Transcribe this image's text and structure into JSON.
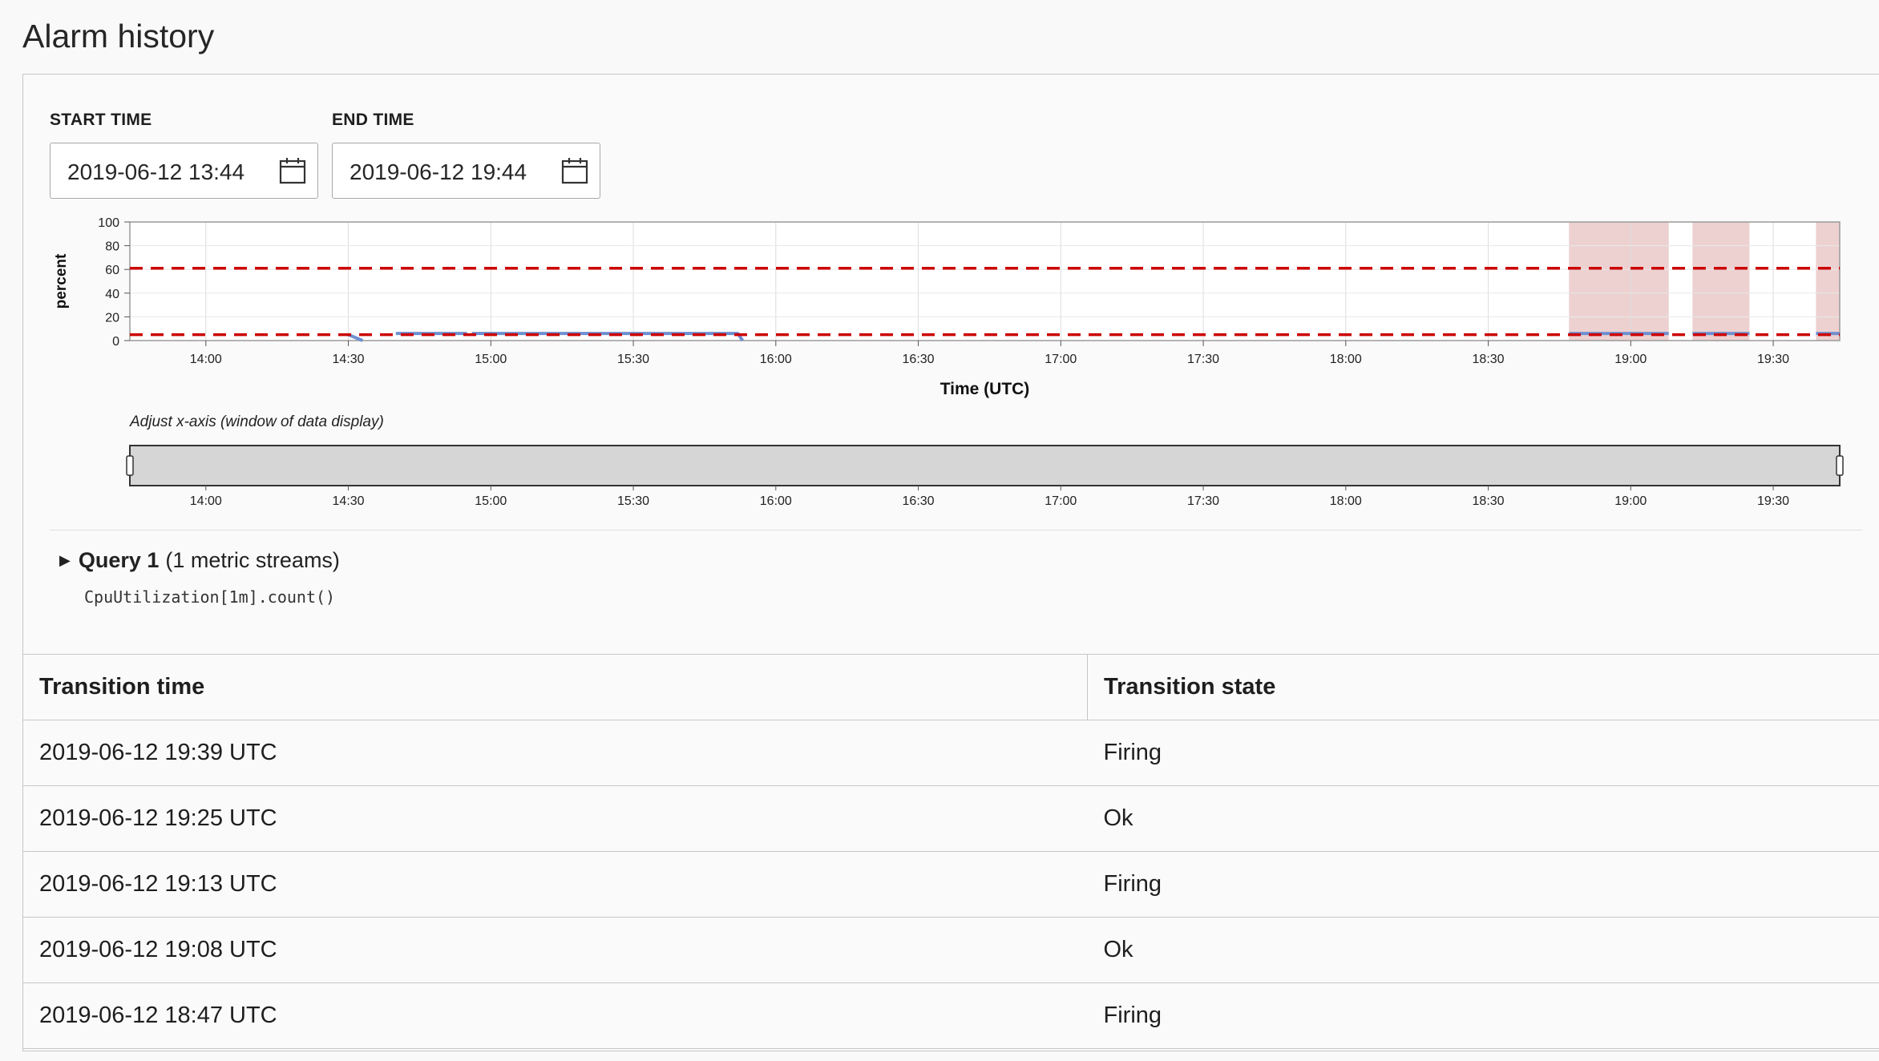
{
  "page_title": "Alarm history",
  "start_time": {
    "label": "START TIME",
    "value": "2019-06-12 13:44",
    "icon": "calendar-icon"
  },
  "end_time": {
    "label": "END TIME",
    "value": "2019-06-12 19:44",
    "icon": "calendar-icon"
  },
  "chart_data": {
    "type": "line",
    "ylabel": "percent",
    "xlabel": "Time (UTC)",
    "ylim": [
      0,
      100
    ],
    "y_ticks": [
      0,
      20,
      40,
      60,
      80,
      100
    ],
    "xlim": [
      "13:44",
      "19:44"
    ],
    "x_ticks": [
      "14:00",
      "14:30",
      "15:00",
      "15:30",
      "16:00",
      "16:30",
      "17:00",
      "17:30",
      "18:00",
      "18:30",
      "19:00",
      "19:30"
    ],
    "grid": true,
    "thresholds": [
      61,
      5
    ],
    "threshold_color": "#cc0000",
    "firing_bands": [
      [
        "18:47",
        "19:08"
      ],
      [
        "19:13",
        "19:25"
      ],
      [
        "19:39",
        "19:44"
      ]
    ],
    "firing_band_color": "#e8c5c5",
    "series": [
      {
        "color": "#6f8fd0",
        "segments": [
          [
            [
              "14:30",
              5
            ],
            [
              "14:33",
              0
            ]
          ],
          [
            [
              "14:40",
              6
            ],
            [
              "14:55",
              6
            ]
          ],
          [
            [
              "14:56",
              6
            ],
            [
              "15:52",
              6
            ],
            [
              "15:53",
              0
            ]
          ],
          [
            [
              "18:47",
              6
            ],
            [
              "19:08",
              6
            ]
          ],
          [
            [
              "19:13",
              6
            ],
            [
              "19:25",
              6
            ]
          ],
          [
            [
              "19:39",
              6
            ],
            [
              "19:44",
              6
            ]
          ]
        ]
      }
    ]
  },
  "slider": {
    "caption": "Adjust x-axis (window of data display)",
    "x_ticks": [
      "14:00",
      "14:30",
      "15:00",
      "15:30",
      "16:00",
      "16:30",
      "17:00",
      "17:30",
      "18:00",
      "18:30",
      "19:00",
      "19:30"
    ]
  },
  "query": {
    "name": "Query 1",
    "streams": "(1 metric streams)",
    "expression": "CpuUtilization[1m].count()"
  },
  "table": {
    "headers": {
      "time": "Transition time",
      "state": "Transition state"
    },
    "rows": [
      {
        "time": "2019-06-12 19:39 UTC",
        "state": "Firing"
      },
      {
        "time": "2019-06-12 19:25 UTC",
        "state": "Ok"
      },
      {
        "time": "2019-06-12 19:13 UTC",
        "state": "Firing"
      },
      {
        "time": "2019-06-12 19:08 UTC",
        "state": "Ok"
      },
      {
        "time": "2019-06-12 18:47 UTC",
        "state": "Firing"
      }
    ]
  }
}
